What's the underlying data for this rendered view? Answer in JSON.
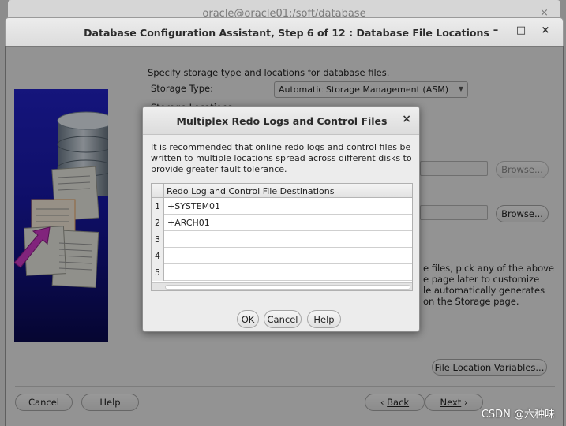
{
  "bg_window": {
    "title": "oracle@oracle01:/soft/database",
    "minimize": "–",
    "close": "×"
  },
  "window": {
    "title": "Database Configuration Assistant, Step 6 of 12 : Database File Locations",
    "minimize": "–",
    "maximize": "□",
    "close": "×"
  },
  "form": {
    "intro": "Specify storage type and locations for database files.",
    "storage_type_label": "Storage Type:",
    "storage_type_value": "Automatic Storage Management (ASM)",
    "storage_locations_label": "Storage Locations:",
    "browse_1": "Browse...",
    "browse_2": "Browse...",
    "info_line_1": "e files, pick any of the above",
    "info_line_2": "e page later to customize",
    "info_line_3": "le automatically generates",
    "info_line_4": "on the Storage page.",
    "file_location_variables": "File Location Variables..."
  },
  "footer": {
    "cancel": "Cancel",
    "help": "Help",
    "back": "Back",
    "next": "Next",
    "back_icon": "chevron-left-icon",
    "next_icon": "chevron-right-icon"
  },
  "dialog": {
    "title": "Multiplex Redo Logs and Control Files",
    "close": "×",
    "message": "It is recommended that online redo logs and control files be written to multiple locations spread across different disks to provide greater fault tolerance.",
    "table": {
      "header": "Redo Log and Control File Destinations",
      "rows": [
        {
          "num": "1",
          "value": "+SYSTEM01"
        },
        {
          "num": "2",
          "value": "+ARCH01"
        },
        {
          "num": "3",
          "value": ""
        },
        {
          "num": "4",
          "value": ""
        },
        {
          "num": "5",
          "value": ""
        }
      ]
    },
    "ok": "OK",
    "cancel": "Cancel",
    "help": "Help"
  },
  "watermark": "CSDN @六种味"
}
